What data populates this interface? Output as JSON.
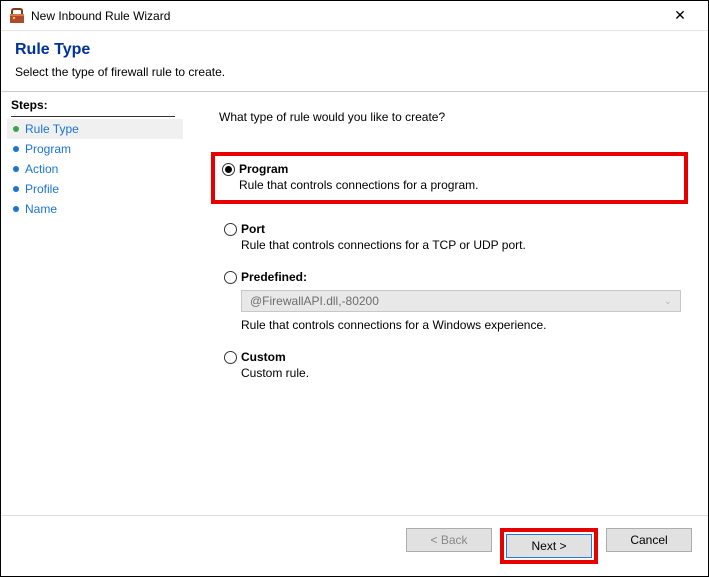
{
  "window": {
    "title": "New Inbound Rule Wizard"
  },
  "header": {
    "title": "Rule Type",
    "subtitle": "Select the type of firewall rule to create."
  },
  "sidebar": {
    "title": "Steps:",
    "items": [
      {
        "label": "Rule Type"
      },
      {
        "label": "Program"
      },
      {
        "label": "Action"
      },
      {
        "label": "Profile"
      },
      {
        "label": "Name"
      }
    ]
  },
  "main": {
    "prompt": "What type of rule would you like to create?",
    "options": {
      "program": {
        "title": "Program",
        "desc": "Rule that controls connections for a program."
      },
      "port": {
        "title": "Port",
        "desc": "Rule that controls connections for a TCP or UDP port."
      },
      "predefined": {
        "title": "Predefined:",
        "dropdown": "@FirewallAPI.dll,-80200",
        "desc": "Rule that controls connections for a Windows experience."
      },
      "custom": {
        "title": "Custom",
        "desc": "Custom rule."
      }
    }
  },
  "footer": {
    "back": "< Back",
    "next": "Next >",
    "cancel": "Cancel"
  }
}
